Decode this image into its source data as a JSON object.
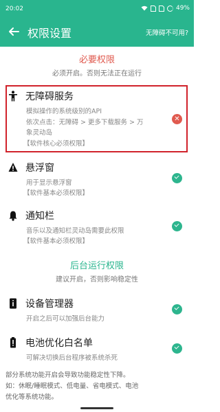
{
  "status_bar": {
    "time": "20:02",
    "battery": "49%",
    "icons": [
      "wifi-icon",
      "sim-icon",
      "sim-icon",
      "battery-icon"
    ]
  },
  "app_bar": {
    "title": "权限设置",
    "help_link": "无障碍不可用?"
  },
  "sections": {
    "required": {
      "title": "必要权限",
      "desc": "必须开启。否则无法正在运行",
      "color": "#e05a4f"
    },
    "background": {
      "title": "后台运行权限",
      "desc": "建议开启，否则影响稳定性",
      "color": "#29b58e"
    }
  },
  "permissions": {
    "accessibility": {
      "icon": "person-icon",
      "title": "无障碍服务",
      "line1": "模拟操作的系统级别的API",
      "line2": "依次点击：无障碍 > 更多下载服务 > 万",
      "line3": "象灵动岛",
      "note": "【软件核心必须权限】",
      "status": "error"
    },
    "overlay": {
      "icon": "warning-icon",
      "title": "悬浮窗",
      "line1": "用于显示悬浮窗",
      "note": "【软件基本必须权限】",
      "status": "ok"
    },
    "notification": {
      "icon": "bell-icon",
      "title": "通知栏",
      "line1": "音乐以及通知栏灵动岛需要此权限",
      "note": "【软件基本必须权限】",
      "status": "ok"
    },
    "device_admin": {
      "icon": "device-admin-icon",
      "title": "设备管理器",
      "line1": "开启之后可以加强后台能力",
      "status": "ok"
    },
    "battery": {
      "icon": "battery-icon",
      "title": "电池优化白名单",
      "line1": "可解决切换后台程序被系统杀死",
      "status": "ok"
    }
  },
  "footer": {
    "line1": "部分系统功能开启会导致功能稳定性下降。",
    "line2": "如：休眠/睡眠模式、低电量、省电模式、电池",
    "line3": "优化等系统功能。"
  },
  "colors": {
    "brand": "#29b58e",
    "error": "#e05a4f",
    "highlight": "#d0212a"
  }
}
